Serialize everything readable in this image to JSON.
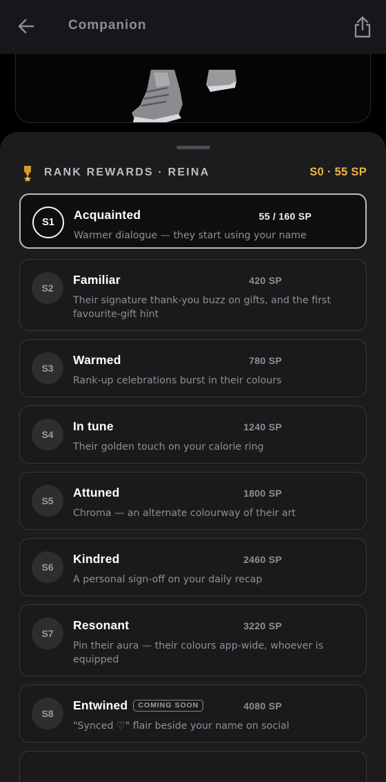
{
  "header": {
    "title": "Companion",
    "back_icon": "arrow-left-icon",
    "share_icon": "share-icon"
  },
  "rank_rewards": {
    "title": "RANK REWARDS · REINA",
    "status": "S0 · 55 SP",
    "accent_color": "#f1b346",
    "tiers": [
      {
        "badge": "S1",
        "name": "Acquainted",
        "sp": "55 / 160 SP",
        "desc": "Warmer dialogue — they start using your name",
        "current": true
      },
      {
        "badge": "S2",
        "name": "Familiar",
        "sp": "420 SP",
        "desc": "Their signature thank-you buzz on gifts, and the first favourite-gift hint"
      },
      {
        "badge": "S3",
        "name": "Warmed",
        "sp": "780 SP",
        "desc": "Rank-up celebrations burst in their colours"
      },
      {
        "badge": "S4",
        "name": "In tune",
        "sp": "1240 SP",
        "desc": "Their golden touch on your calorie ring"
      },
      {
        "badge": "S5",
        "name": "Attuned",
        "sp": "1800 SP",
        "desc": "Chroma — an alternate colourway of their art"
      },
      {
        "badge": "S6",
        "name": "Kindred",
        "sp": "2460 SP",
        "desc": "A personal sign-off on your daily recap"
      },
      {
        "badge": "S7",
        "name": "Resonant",
        "sp": "3220 SP",
        "desc": "Pin their aura — their colours app-wide, whoever is equipped"
      },
      {
        "badge": "S8",
        "name": "Entwined",
        "tag": "COMING SOON",
        "sp": "4080 SP",
        "desc": "\"Synced ♡\" flair beside your name on social"
      }
    ]
  }
}
